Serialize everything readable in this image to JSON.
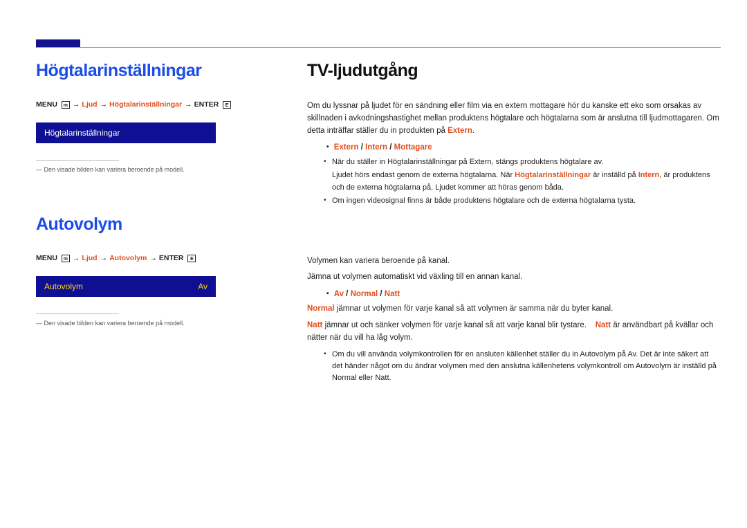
{
  "left": {
    "sec1": {
      "title": "Högtalarinställningar",
      "path_menu": "MENU",
      "path_menu_icon": "m",
      "path_p1": "Ljud",
      "path_arrows": "→",
      "path_p2": "Högtalarinställningar",
      "path_enter": "ENTER",
      "menubox_label": "Högtalarinställningar",
      "footnote": "Den visade bilden kan variera beroende på modell."
    },
    "sec2": {
      "title": "Autovolym",
      "path_menu": "MENU",
      "path_menu_icon": "m",
      "path_p1": "Ljud",
      "path_arrows": "→",
      "path_p2": "Autovolym",
      "path_enter": "ENTER",
      "menubox_label": "Autovolym",
      "menubox_value": "Av",
      "footnote": "Den visade bilden kan variera beroende på modell."
    }
  },
  "right": {
    "sec1": {
      "title": "TV-ljudutgång",
      "para": "Om du lyssnar på ljudet för en sändning eller film via en extern mottagare hör du kanske ett eko som orsakas av skillnaden i avkodningshastighet mellan produktens högtalare och högtalarna som är anslutna till ljudmottagaren. Om detta inträffar ställer du in produkten på ",
      "para_end": "Extern",
      "para_period": ".",
      "emph_prefix": "・",
      "emph_label": "Extern",
      "emph_sep1": " / ",
      "emph_label2": "Intern",
      "emph_sep2": " / ",
      "emph_label3": "Mottagare",
      "b1a": "När du ställer in ",
      "b1a_o1": "Högtalarinställningar",
      "b1a_mid": " på ",
      "b1a_o2": "Extern",
      "b1a_end": ", stängs produktens högtalare av.",
      "b1b_pre": "Ljudet hörs endast genom de externa högtalarna. När ",
      "b1b_o1": "Högtalarinställningar",
      "b1b_mid": " är inställd på ",
      "b1b_o2": "Intern",
      "b1b_end": ", är produktens och de externa högtalarna på. Ljudet kommer att höras genom båda.",
      "b2": "Om ingen videosignal finns är både produktens högtalare och de externa högtalarna tysta."
    },
    "sec2": {
      "p1": "Volymen kan variera beroende på kanal.",
      "p2": "Jämna ut volymen automatiskt vid växling till en annan kanal.",
      "emph_prefix": "・",
      "emph_l1": "Av",
      "emph_sep1": " / ",
      "emph_l2": "Normal",
      "emph_sep2": " / ",
      "emph_l3": "Natt",
      "r1_o": "Normal",
      "r1_t": " jämnar ut volymen för varje kanal så att volymen är samma när du byter kanal.",
      "r2_o": "Natt",
      "r2_t": " jämnar ut och sänker volymen för varje kanal så att varje kanal blir tystare. ",
      "r2_o2": "Natt",
      "r2_t2": " är användbart på kvällar och nätter när du vill ha låg volym.",
      "b1_pre": "Om du vill använda volymkontrollen för en ansluten källenhet ställer du in ",
      "b1_o1": "Autovolym",
      "b1_mid1": " på ",
      "b1_o2": "Av",
      "b1_mid2": ". Det är inte säkert att det händer något om du ändrar volymen med den anslutna källenhetens volymkontroll om ",
      "b1_o3": "Autovolym",
      "b1_mid3": " är inställd på ",
      "b1_o4": "Normal",
      "b1_mid4": " eller ",
      "b1_o5": "Natt",
      "b1_end": "."
    }
  }
}
